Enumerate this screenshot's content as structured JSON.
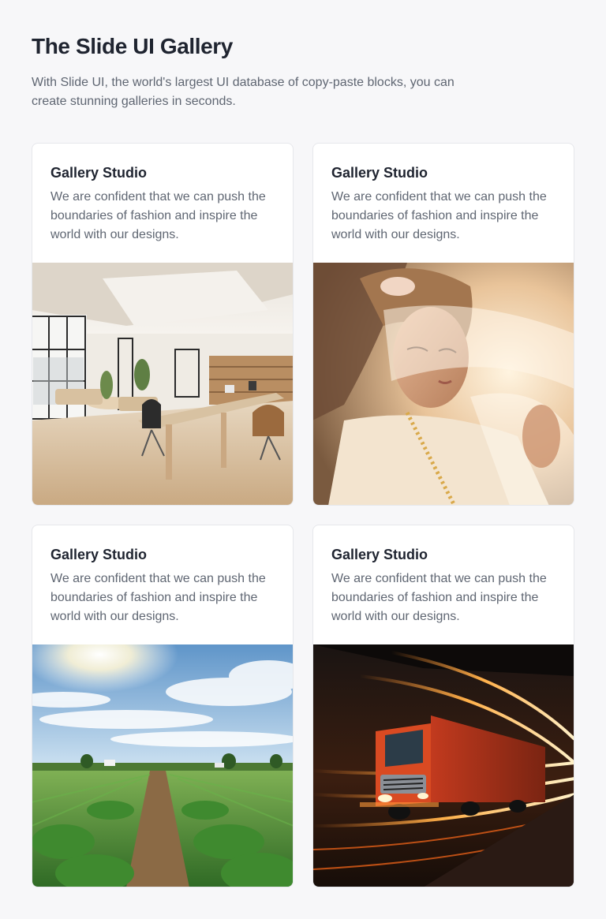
{
  "header": {
    "title": "The Slide UI Gallery",
    "subtitle": "With Slide UI, the world's largest UI database of copy-paste blocks, you can create stunning galleries in seconds."
  },
  "cards": [
    {
      "title": "Gallery Studio",
      "text": "We are confident that we can push the boundaries of fashion and inspire the world with our designs.",
      "image": "office-interior-image"
    },
    {
      "title": "Gallery Studio",
      "text": "We are confident that we can push the boundaries of fashion and inspire the world with our designs.",
      "image": "woman-portrait-image"
    },
    {
      "title": "Gallery Studio",
      "text": "We are confident that we can push the boundaries of fashion and inspire the world with our designs.",
      "image": "farm-field-image"
    },
    {
      "title": "Gallery Studio",
      "text": "We are confident that we can push the boundaries of fashion and inspire the world with our designs.",
      "image": "truck-motion-image"
    }
  ]
}
